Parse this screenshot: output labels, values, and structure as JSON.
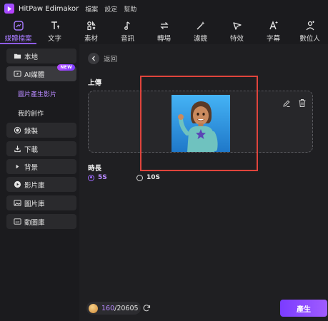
{
  "app": {
    "title": "HitPaw Edimakor",
    "menu": [
      "檔案",
      "設定",
      "幫助"
    ]
  },
  "toolbar": {
    "items": [
      {
        "label": "媒體檔案",
        "icon": "media-icon",
        "active": true
      },
      {
        "label": "文字",
        "icon": "text-icon"
      },
      {
        "label": "素材",
        "icon": "elements-icon"
      },
      {
        "label": "音訊",
        "icon": "audio-icon"
      },
      {
        "label": "轉場",
        "icon": "transition-icon"
      },
      {
        "label": "濾鏡",
        "icon": "filter-icon"
      },
      {
        "label": "特效",
        "icon": "effects-icon"
      },
      {
        "label": "字幕",
        "icon": "subtitle-icon"
      },
      {
        "label": "數位人",
        "icon": "digital-human-icon"
      }
    ],
    "accent": "#8f5cff"
  },
  "sidebar": {
    "local": "本地",
    "ai_media": "AI媒體",
    "new_badge": "NEW",
    "sub_image_to_video": "圖片產生影片",
    "sub_my_creations": "我的創作",
    "record": "錄製",
    "download": "下載",
    "background": "背景",
    "video_library": "影片庫",
    "image_library": "圖片庫",
    "gif_library": "動圖庫"
  },
  "main": {
    "back_label": "返回",
    "upload_label": "上傳",
    "duration_label": "時長",
    "durations": [
      {
        "label": "5S",
        "selected": true
      },
      {
        "label": "10S",
        "selected": false
      }
    ]
  },
  "footer": {
    "credits_used": "160",
    "credits_total": "/20605",
    "generate_label": "產生"
  }
}
